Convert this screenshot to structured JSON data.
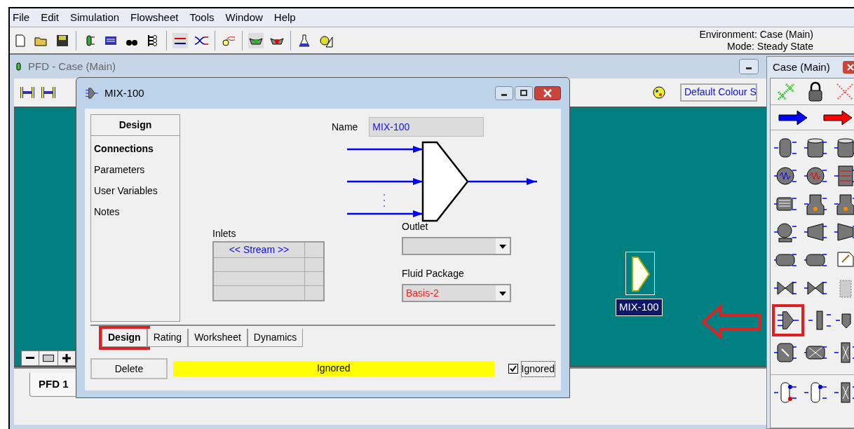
{
  "menu": [
    {
      "label": "File"
    },
    {
      "label": "Edit"
    },
    {
      "label": "Simulation"
    },
    {
      "label": "Flowsheet"
    },
    {
      "label": "Tools"
    },
    {
      "label": "Window"
    },
    {
      "label": "Help"
    }
  ],
  "status": {
    "environment": "Environment: Case (Main)",
    "mode": "Mode: Steady State"
  },
  "pfd_window": {
    "title": "PFD - Case (Main)",
    "colour_scheme": "Default Colour S",
    "unit_label": "MIX-100",
    "tabs": [
      {
        "label": "PFD 1",
        "selected": true
      }
    ]
  },
  "dialog": {
    "title": "MIX-100",
    "nav_header": "Design",
    "nav_items": [
      {
        "label": "Connections",
        "selected": true
      },
      {
        "label": "Parameters",
        "selected": false
      },
      {
        "label": "User Variables",
        "selected": false
      },
      {
        "label": "Notes",
        "selected": false
      }
    ],
    "name_label": "Name",
    "name_value": "MIX-100",
    "inlets_label": "Inlets",
    "inlets_header": "<< Stream >>",
    "outlet_label": "Outlet",
    "fluid_package_label": "Fluid Package",
    "fluid_package_value": "Basis-2",
    "tabs": [
      {
        "label": "Design",
        "selected": true
      },
      {
        "label": "Rating",
        "selected": false
      },
      {
        "label": "Worksheet",
        "selected": false
      },
      {
        "label": "Dynamics",
        "selected": false
      }
    ],
    "delete_button": "Delete",
    "status_text": "Ignored",
    "ignored": {
      "label": "Ignored",
      "checked": true
    }
  },
  "palette": {
    "title": "Case (Main)"
  }
}
